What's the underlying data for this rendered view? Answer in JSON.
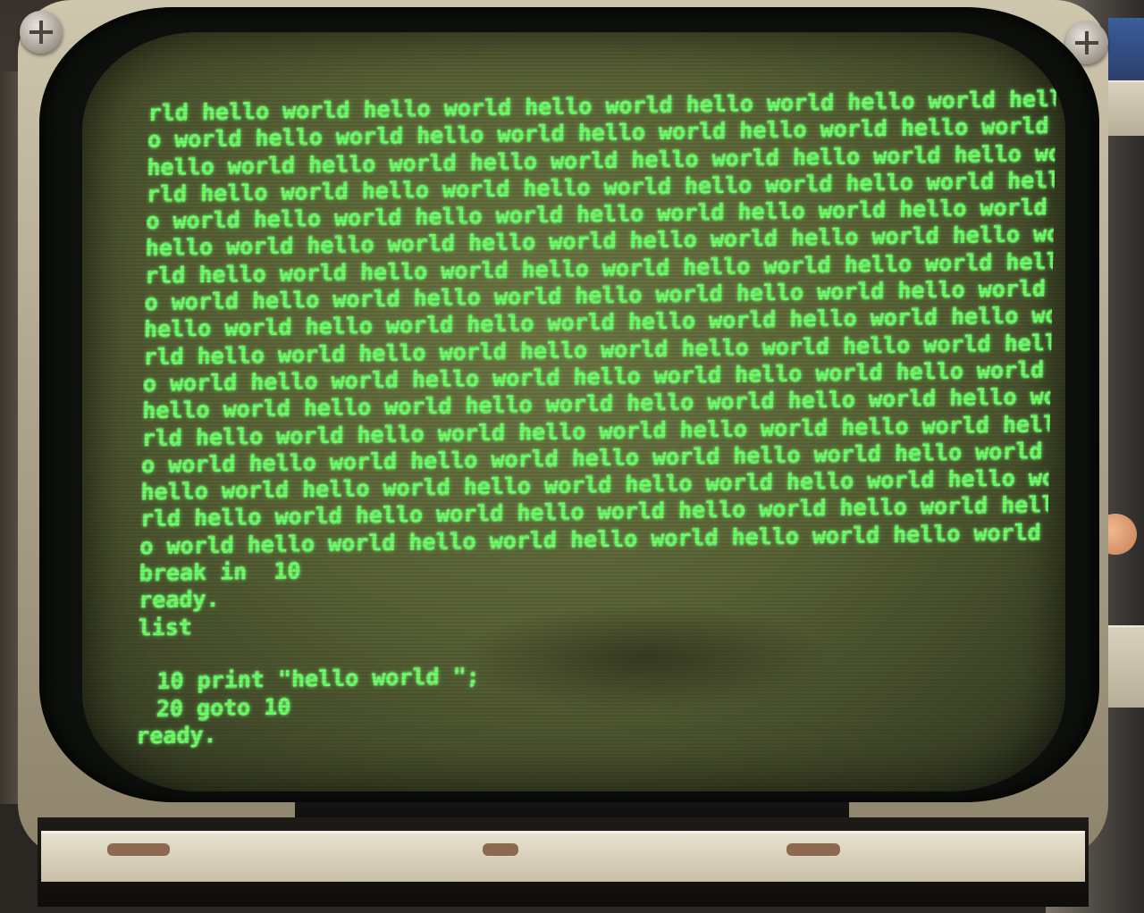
{
  "terminal": {
    "lines": [
      {
        "text": "rld hello world hello world hello world hello world hello world hello world h",
        "kind": "output"
      },
      {
        "text": "o world hello world hello world hello world hello world hello world hello wo",
        "kind": "output"
      },
      {
        "text": "hello world hello world hello world hello world hello world hello world hello",
        "kind": "output"
      },
      {
        "text": "rld hello world hello world hello world hello world hello world hello world h",
        "kind": "output"
      },
      {
        "text": "o world hello world hello world hello world hello world hello world hello wor",
        "kind": "output"
      },
      {
        "text": "hello world hello world hello world hello world hello world hello world hello",
        "kind": "output"
      },
      {
        "text": "rld hello world hello world hello world hello world hello world hello world he",
        "kind": "output"
      },
      {
        "text": "o world hello world hello world hello world hello world hello world hello wor",
        "kind": "output"
      },
      {
        "text": "hello world hello world hello world hello world hello world hello world hello",
        "kind": "output"
      },
      {
        "text": "rld hello world hello world hello world hello world hello world hello world he",
        "kind": "output"
      },
      {
        "text": "o world hello world hello world hello world hello world hello world hello wor",
        "kind": "output"
      },
      {
        "text": "hello world hello world hello world hello world hello world hello world hello",
        "kind": "output"
      },
      {
        "text": "rld hello world hello world hello world hello world hello world hello world he",
        "kind": "output"
      },
      {
        "text": "o world hello world hello world hello world hello world hello world hello wor",
        "kind": "output"
      },
      {
        "text": "hello world hello world hello world hello world hello world hello world hello",
        "kind": "output"
      },
      {
        "text": "rld hello world hello world hello world hello world hello world hello world he",
        "kind": "output"
      },
      {
        "text": "o world hello world hello world hello world hello world hello world",
        "kind": "output"
      },
      {
        "text": "break in  10",
        "kind": "status"
      },
      {
        "text": "ready.",
        "kind": "status"
      },
      {
        "text": "list",
        "kind": "command"
      },
      {
        "text": "",
        "kind": "blank"
      },
      {
        "text": "10 print \"hello world \";",
        "kind": "listing"
      },
      {
        "text": "20 goto 10",
        "kind": "listing"
      },
      {
        "text": "ready.",
        "kind": "status"
      }
    ]
  },
  "colors": {
    "phosphor": "#6dff6a",
    "screen": "#5a6336",
    "bezel": "#0d100c",
    "chassis": "#cfc6ae"
  }
}
